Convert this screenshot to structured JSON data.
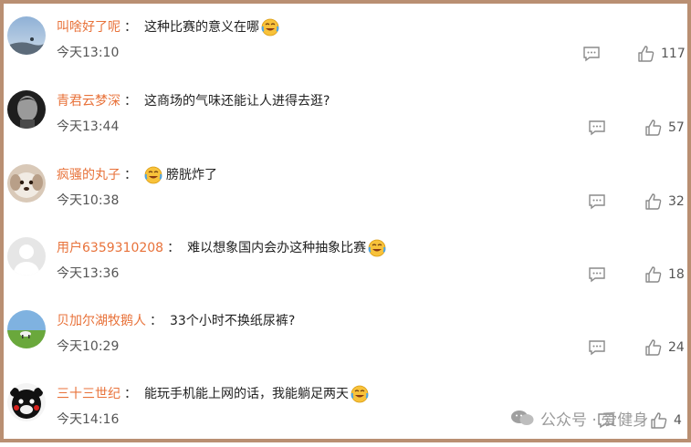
{
  "comments": [
    {
      "username": "叫啥好了呢",
      "sep": "：",
      "text": "这种比赛的意义在哪",
      "emoji_trailing": true,
      "emoji_leading": false,
      "time": "今天13:10",
      "likes": "117",
      "avatar": "sky-avatar"
    },
    {
      "username": "青君云梦深",
      "sep": "：",
      "text": "这商场的气味还能让人进得去逛?",
      "emoji_trailing": false,
      "emoji_leading": false,
      "time": "今天13:44",
      "likes": "57",
      "avatar": "man-portrait-avatar"
    },
    {
      "username": "疯骚的丸子",
      "sep": "：",
      "text": "膀胱炸了",
      "emoji_trailing": false,
      "emoji_leading": true,
      "time": "今天10:38",
      "likes": "32",
      "avatar": "dog-avatar"
    },
    {
      "username": "用户6359310208",
      "sep": "：",
      "text": "难以想象国内会办这种抽象比赛",
      "emoji_trailing": true,
      "emoji_leading": false,
      "time": "今天13:36",
      "likes": "18",
      "avatar": "default-avatar"
    },
    {
      "username": "贝加尔湖牧鹅人",
      "sep": "：",
      "text": "33个小时不换纸尿裤?",
      "emoji_trailing": false,
      "emoji_leading": false,
      "time": "今天10:29",
      "likes": "24",
      "avatar": "meadow-avatar"
    },
    {
      "username": "三十三世纪",
      "sep": "：",
      "text": "能玩手机能上网的话，我能躺足两天",
      "emoji_trailing": true,
      "emoji_leading": false,
      "time": "今天14:16",
      "likes": "4",
      "avatar": "kumamon-avatar"
    }
  ],
  "watermark": {
    "text": "公众号 · 爱健身",
    "icon": "wechat-icon"
  },
  "colors": {
    "username": "#e8723a",
    "border": "#b98f72",
    "icon": "#8a8a8a"
  }
}
